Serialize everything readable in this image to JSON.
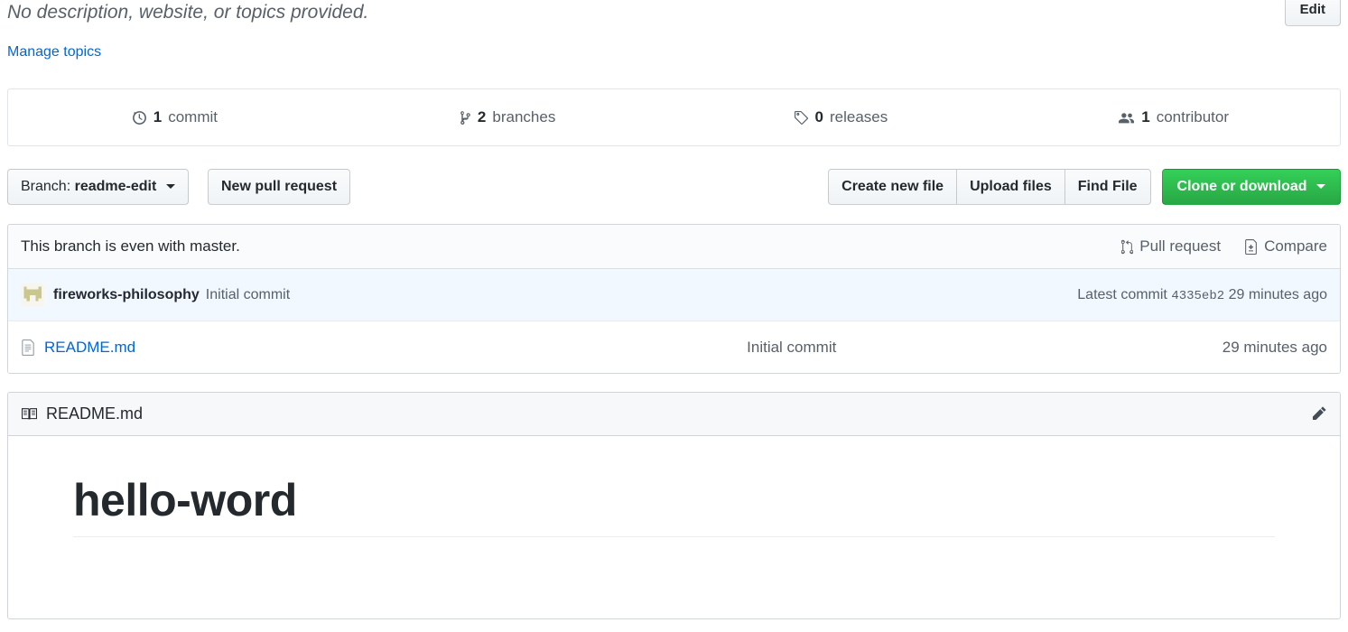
{
  "repo_header": {
    "description": "No description, website, or topics provided.",
    "edit_label": "Edit",
    "manage_topics_label": "Manage topics"
  },
  "stats": [
    {
      "icon": "history-icon",
      "count": "1",
      "label": "commit"
    },
    {
      "icon": "git-branch-icon",
      "count": "2",
      "label": "branches"
    },
    {
      "icon": "tag-icon",
      "count": "0",
      "label": "releases"
    },
    {
      "icon": "people-icon",
      "count": "1",
      "label": "contributor"
    }
  ],
  "actions": {
    "branch_prefix": "Branch:",
    "branch_name": "readme-edit",
    "new_pull_request": "New pull request",
    "create_new_file": "Create new file",
    "upload_files": "Upload files",
    "find_file": "Find File",
    "clone_or_download": "Clone or download",
    "clone_color": "#28a745"
  },
  "branch_status": {
    "message": "This branch is even with master.",
    "pull_request_label": "Pull request",
    "compare_label": "Compare"
  },
  "latest_commit": {
    "author": "fireworks-philosophy",
    "message": "Initial commit",
    "latest_commit_label": "Latest commit",
    "sha": "4335eb2",
    "time": "29 minutes ago",
    "avatar_color": "#c9c78f"
  },
  "files": [
    {
      "icon": "file-icon",
      "name": "README.md",
      "commit_message": "Initial commit",
      "time": "29 minutes ago"
    }
  ],
  "readme": {
    "icon": "book-icon",
    "title": "README.md",
    "edit_icon": "pencil-icon",
    "heading": "hello-word"
  }
}
